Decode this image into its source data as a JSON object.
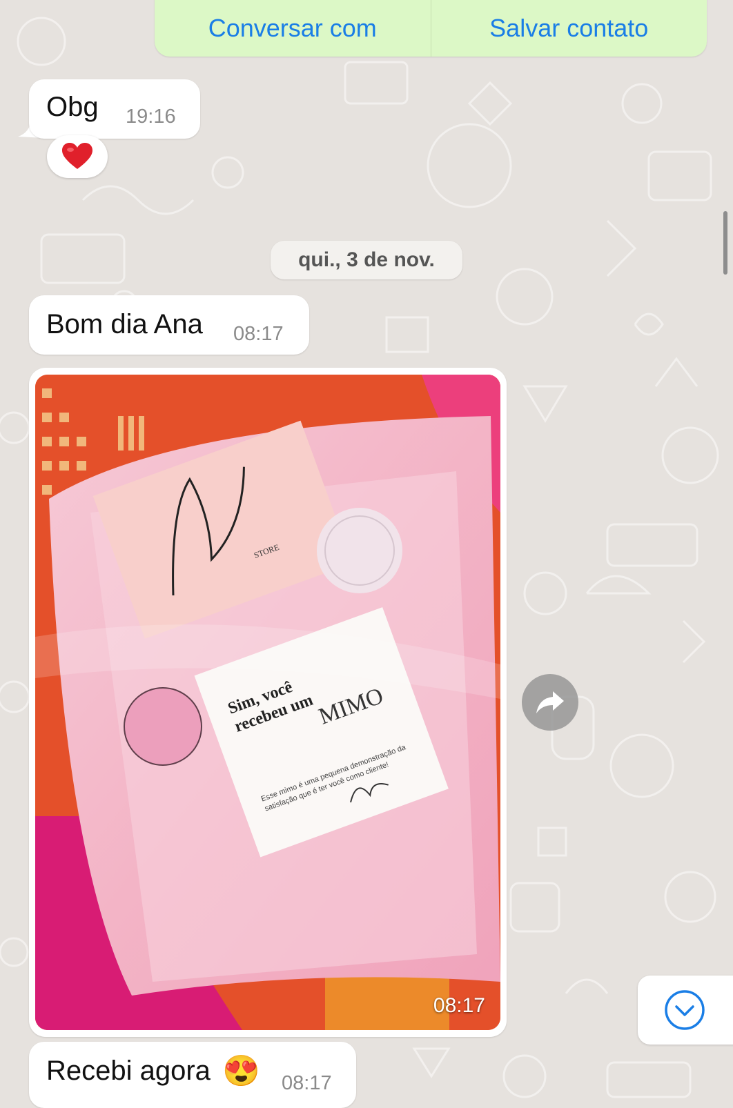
{
  "contact_card": {
    "action_chat": "Conversar com",
    "action_save": "Salvar contato"
  },
  "messages": [
    {
      "text": "Obg",
      "time": "19:16",
      "reaction": "❤️"
    },
    {
      "text": "Bom dia Ana",
      "time": "08:17"
    },
    {
      "type": "image",
      "time": "08:17",
      "photo_text": {
        "brand": "Ana Rufatto",
        "brand_sub": "STORE",
        "card_heading": "Sim, você recebeu um",
        "card_highlight": "MIMO",
        "card_body": "Esse mimo é uma pequena demonstração da satisfação que é ter você como cliente!",
        "card_signature": "Ana Rufatto"
      }
    },
    {
      "text": "Recebi agora",
      "emoji": "😍",
      "time": "08:17"
    }
  ],
  "date_separator": "qui., 3 de nov.",
  "icons": {
    "forward": "forward-arrow-icon",
    "scroll_down": "chevron-down-circle-icon",
    "reaction": "red-heart"
  },
  "colors": {
    "chat_background": "#e6e2de",
    "outgoing_bubble": "#dcf8c6",
    "incoming_bubble": "#ffffff",
    "link_blue": "#1a7ee6",
    "timestamp": "#8a8a8a"
  }
}
